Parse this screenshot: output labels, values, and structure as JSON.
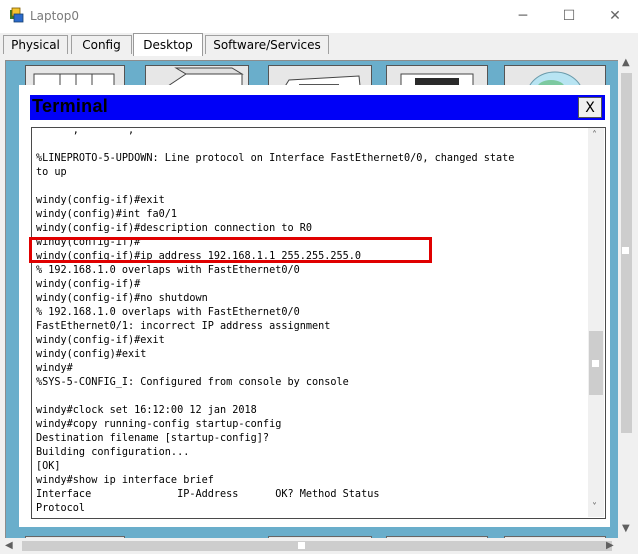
{
  "window": {
    "title": "Laptop0",
    "minimize_glyph": "─",
    "maximize_glyph": "☐",
    "close_glyph": "✕",
    "icon": "packet-tracer-laptop-icon"
  },
  "tabs": [
    {
      "label": "Physical",
      "active": false
    },
    {
      "label": "Config",
      "active": false
    },
    {
      "label": "Desktop",
      "active": true
    },
    {
      "label": "Software/Services",
      "active": false
    }
  ],
  "terminal": {
    "title": "Terminal",
    "close_label": "X",
    "lines": [
      "      ,        ,                                    ",
      "",
      "%LINEPROTO-5-UPDOWN: Line protocol on Interface FastEthernet0/0, changed state",
      "to up",
      "",
      "windy(config-if)#exit",
      "windy(config)#int fa0/1",
      "windy(config-if)#description connection to R0",
      "windy(config-if)#",
      "windy(config-if)#ip address 192.168.1.1 255.255.255.0",
      "% 192.168.1.0 overlaps with FastEthernet0/0",
      "windy(config-if)#",
      "windy(config-if)#no shutdown",
      "% 192.168.1.0 overlaps with FastEthernet0/0",
      "FastEthernet0/1: incorrect IP address assignment",
      "windy(config-if)#exit",
      "windy(config)#exit",
      "windy#",
      "%SYS-5-CONFIG_I: Configured from console by console",
      "",
      "windy#clock set 16:12:00 12 jan 2018",
      "windy#copy running-config startup-config",
      "Destination filename [startup-config]?",
      "Building configuration...",
      "[OK]",
      "windy#show ip interface brief",
      "Interface              IP-Address      OK? Method Status",
      "Protocol"
    ]
  },
  "colors": {
    "terminal_titlebar": "#0000f7",
    "desktop_background": "#6aaecb",
    "highlight_box": "#e00000"
  }
}
